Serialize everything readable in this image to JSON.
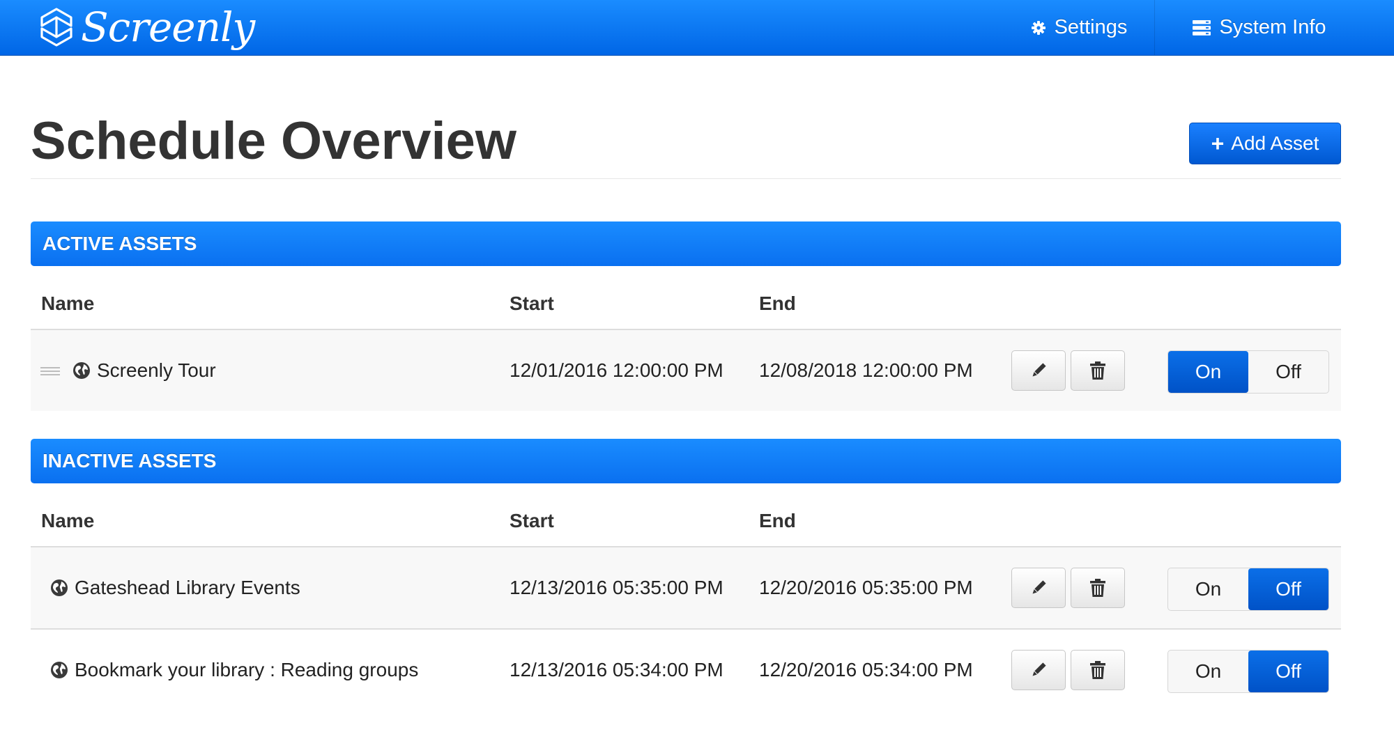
{
  "nav": {
    "brand": "Screenly",
    "settings_label": "Settings",
    "sysinfo_label": "System Info"
  },
  "page": {
    "title": "Schedule Overview",
    "add_button_label": "Add Asset"
  },
  "columns": {
    "name": "Name",
    "start": "Start",
    "end": "End"
  },
  "toggle_labels": {
    "on": "On",
    "off": "Off"
  },
  "active": {
    "heading": "ACTIVE ASSETS",
    "rows": [
      {
        "name": "Screenly Tour",
        "start": "12/01/2016 12:00:00 PM",
        "end": "12/08/2018 12:00:00 PM",
        "state": "on"
      }
    ]
  },
  "inactive": {
    "heading": "INACTIVE ASSETS",
    "rows": [
      {
        "name": "Gateshead Library Events",
        "start": "12/13/2016 05:35:00 PM",
        "end": "12/20/2016 05:35:00 PM",
        "state": "off"
      },
      {
        "name": "Bookmark your library : Reading groups",
        "start": "12/13/2016 05:34:00 PM",
        "end": "12/20/2016 05:34:00 PM",
        "state": "off"
      }
    ]
  },
  "colors": {
    "primary": "#1a8cff",
    "primary_dark": "#0052c7",
    "text": "#333333"
  }
}
